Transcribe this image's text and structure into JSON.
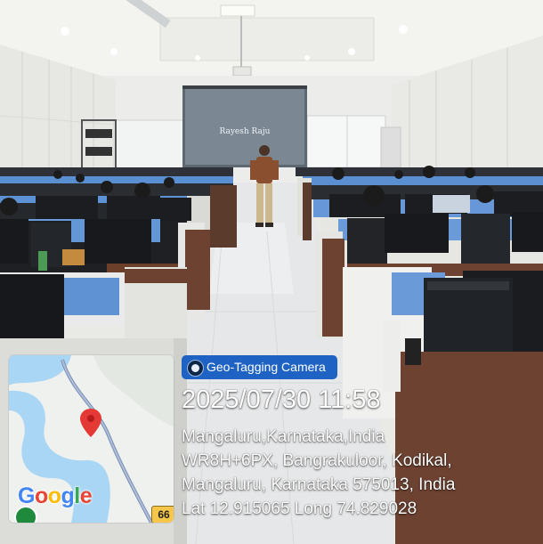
{
  "scene": {
    "description_hidden": "",
    "projector_slide_name": "Rayesh Raju"
  },
  "map": {
    "logo": {
      "letters": [
        "G",
        "o",
        "o",
        "g",
        "l",
        "e"
      ],
      "colors": [
        "#4285f4",
        "#ea4335",
        "#fbbc05",
        "#4285f4",
        "#34a853",
        "#ea4335"
      ]
    },
    "route_badge": "66",
    "pin_color": "#e53935",
    "river_color": "#a9d6f5",
    "road_color": "#7b8fb4"
  },
  "overlay": {
    "app_name": "Geo-Tagging Camera",
    "app_color": "#1e63c4",
    "datetime": "2025/07/30 11:58",
    "line1": "Mangaluru,Karnataka,India",
    "line2": "WR8H+6PX, Bangrakuloor, Kodikal,",
    "line3": "Mangaluru, Karnataka 575013, India",
    "line4": "Lat 12.915065 Long 74.829028"
  }
}
